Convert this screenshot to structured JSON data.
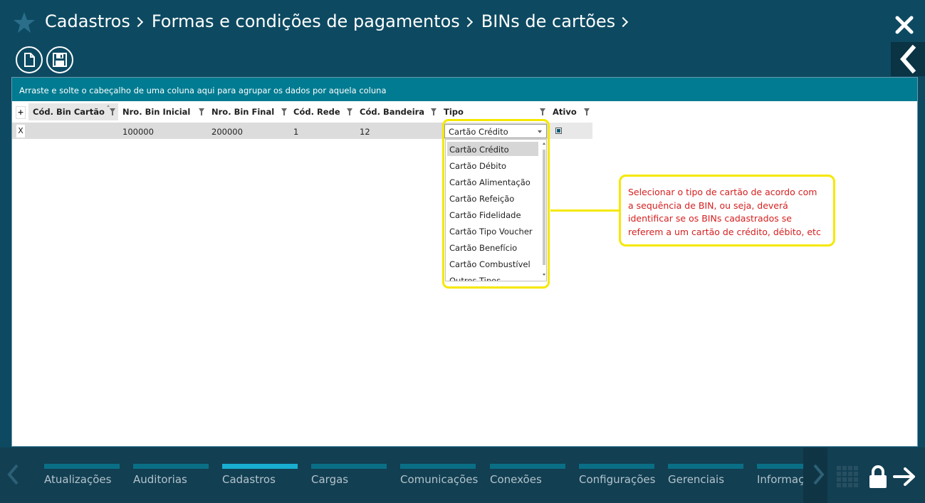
{
  "header": {
    "breadcrumbs": [
      "Cadastros",
      "Formas e condições de pagamentos",
      "BINs de cartões"
    ],
    "icons": [
      "star-icon",
      "close-icon",
      "back-chevron-icon",
      "new-document-icon",
      "save-icon"
    ]
  },
  "grid": {
    "group_hint": "Arraste e solte o cabeçalho de uma coluna aqui para agrupar os dados por aquela coluna",
    "add_symbol": "+",
    "columns": [
      "Cód. Bin Cartão",
      "Nro. Bin Inicial",
      "Nro. Bin Final",
      "Cód. Rede",
      "Cód. Bandeira",
      "Tipo",
      "Ativo"
    ],
    "rows": [
      {
        "delete_symbol": "X",
        "cod_bin_cartao": "",
        "nro_bin_inicial": "100000",
        "nro_bin_final": "200000",
        "cod_rede": "1",
        "cod_bandeira": "12",
        "tipo": "Cartão Crédito",
        "ativo": true
      }
    ]
  },
  "tipo_dropdown": {
    "selected": "Cartão Crédito",
    "options": [
      "Cartão Crédito",
      "Cartão Débito",
      "Cartão Alimentação",
      "Cartão Refeição",
      "Cartão Fidelidade",
      "Cartão Tipo Voucher",
      "Cartão Benefício",
      "Cartão Combustível",
      "Outros Tipos"
    ]
  },
  "annotation": {
    "lines": [
      "Selecionar o tipo de cartão de acordo com",
      "a sequência de BIN, ou seja, deverá",
      "identificar se os BINs cadastrados se",
      "referem a um cartão de crédito, débito, etc"
    ],
    "color": "#d62020",
    "highlight_color": "#f5e800"
  },
  "bottom_menu": {
    "items": [
      "Atualizações",
      "Auditorias",
      "Cadastros",
      "Cargas",
      "Comunicações",
      "Conexões",
      "Configurações",
      "Gerenciais",
      "Informações"
    ],
    "active": "Cadastros",
    "icons": [
      "nav-left-icon",
      "nav-right-icon",
      "grid-icon",
      "lock-icon",
      "exit-arrow-icon"
    ]
  },
  "colors": {
    "background": "#0d4a62",
    "group_bar": "#007b91",
    "active_menu_bar": "#19aed0",
    "menu_bar": "#0a6f86"
  }
}
